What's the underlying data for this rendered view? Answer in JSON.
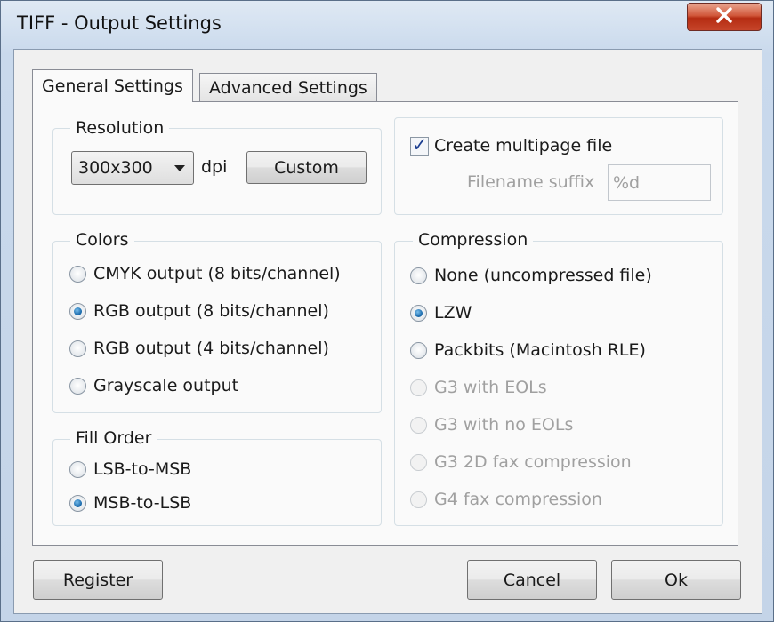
{
  "window": {
    "title": "TIFF - Output Settings",
    "close_glyph": "X"
  },
  "tabs": [
    {
      "label": "General Settings",
      "active": true
    },
    {
      "label": "Advanced Settings",
      "active": false
    }
  ],
  "resolution": {
    "legend": "Resolution",
    "selected": "300x300",
    "unit": "dpi",
    "custom_label": "Custom"
  },
  "multipage": {
    "checkbox_label": "Create multipage file",
    "checked": true,
    "suffix_label": "Filename suffix",
    "suffix_value": "%d"
  },
  "colors": {
    "legend": "Colors",
    "options": [
      {
        "label": "CMYK output (8 bits/channel)",
        "checked": false
      },
      {
        "label": "RGB output (8 bits/channel)",
        "checked": true
      },
      {
        "label": "RGB output (4 bits/channel)",
        "checked": false
      },
      {
        "label": "Grayscale output",
        "checked": false
      }
    ]
  },
  "fill_order": {
    "legend": "Fill Order",
    "options": [
      {
        "label": "LSB-to-MSB",
        "checked": false
      },
      {
        "label": "MSB-to-LSB",
        "checked": true
      }
    ]
  },
  "compression": {
    "legend": "Compression",
    "options": [
      {
        "label": "None (uncompressed file)",
        "checked": false,
        "enabled": true
      },
      {
        "label": "LZW",
        "checked": true,
        "enabled": true
      },
      {
        "label": "Packbits (Macintosh RLE)",
        "checked": false,
        "enabled": true
      },
      {
        "label": "G3 with EOLs",
        "checked": false,
        "enabled": false
      },
      {
        "label": "G3 with no EOLs",
        "checked": false,
        "enabled": false
      },
      {
        "label": "G3 2D fax compression",
        "checked": false,
        "enabled": false
      },
      {
        "label": "G4 fax compression",
        "checked": false,
        "enabled": false
      }
    ]
  },
  "buttons": {
    "register": "Register",
    "cancel": "Cancel",
    "ok": "Ok"
  },
  "colors_theme": {
    "accent": "#1f6fb0",
    "close_red": "#c6452a",
    "disabled_text": "#a0a0a0"
  }
}
